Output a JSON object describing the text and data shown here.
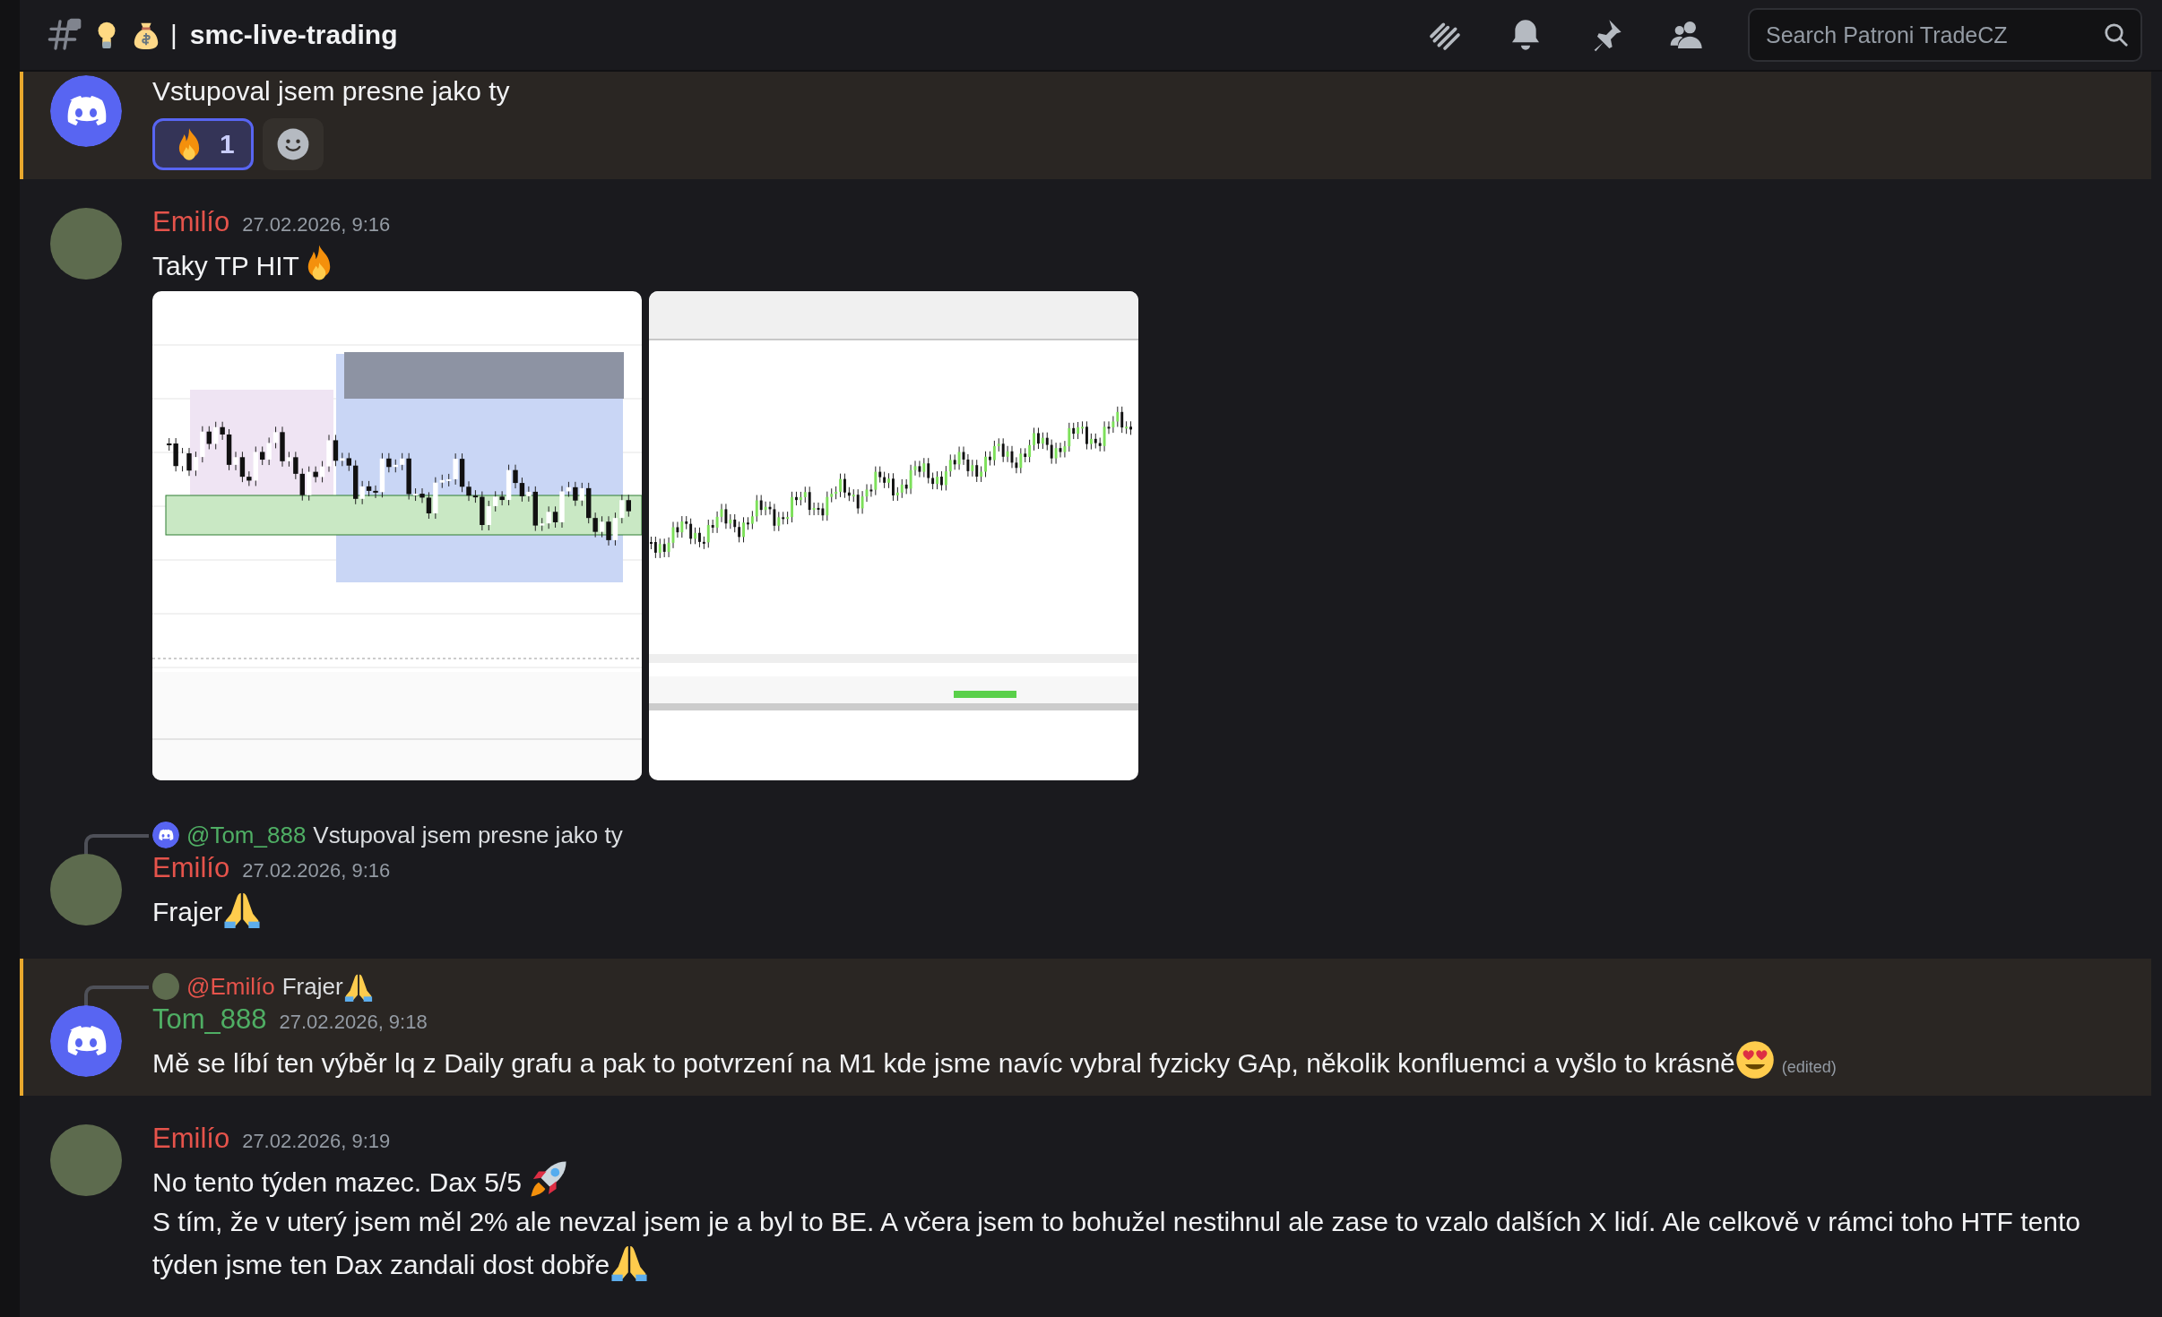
{
  "channel": {
    "emojis": [
      {
        "kind": "bulb"
      },
      {
        "kind": "moneybag"
      }
    ],
    "separator": "|",
    "name": "smc-live-trading"
  },
  "toolbar": [
    {
      "kind": "threads"
    },
    {
      "kind": "bell"
    },
    {
      "kind": "pin"
    },
    {
      "kind": "members"
    }
  ],
  "search": {
    "placeholder": "Search Patroni TradeCZ"
  },
  "messages": [
    {
      "mentioned": true,
      "avatar": {
        "kind": "default"
      },
      "lines": [
        {
          "text": "Vstupoval jsem presne jako ty"
        }
      ],
      "reactions": [
        {
          "emoji": {
            "kind": "fire"
          },
          "count": "1",
          "selected": true
        }
      ],
      "add_reaction": true
    },
    {
      "mentioned": false,
      "avatar": {
        "kind": "photo"
      },
      "author": "Emilío",
      "color": "#e5534b",
      "time": "27.02.2026, 9:16",
      "lines": [
        {
          "text": "Taky TP HIT",
          "emoji": {
            "kind": "fire"
          }
        }
      ],
      "attachments": [
        {
          "kind": "zones"
        },
        {
          "kind": "line"
        }
      ]
    },
    {
      "mentioned": false,
      "avatar": {
        "kind": "photo"
      },
      "reply": {
        "avatar": {
          "kind": "default"
        },
        "mention": "@Tom_888",
        "color": "#4fae64",
        "text": "Vstupoval jsem presne jako ty"
      },
      "author": "Emilío",
      "color": "#e5534b",
      "time": "27.02.2026, 9:16",
      "lines": [
        {
          "text": "Frajer",
          "emoji": {
            "kind": "pray"
          }
        }
      ]
    },
    {
      "mentioned": true,
      "avatar": {
        "kind": "default"
      },
      "reply": {
        "avatar": {
          "kind": "photo"
        },
        "mention": "@Emilío",
        "color": "#e5534b",
        "text": "Frajer",
        "emoji": {
          "kind": "pray"
        }
      },
      "author": "Tom_888",
      "color": "#4fae64",
      "time": "27.02.2026, 9:18",
      "lines": [
        {
          "text": "Mě se líbí ten výběr lq z Daily grafu a pak to potvrzení na M1 kde jsme navíc vybral fyzicky GAp, několik  konfluemci a vyšlo to krásně",
          "emoji": {
            "kind": "heart-eyes"
          },
          "edited": "(edited)"
        }
      ]
    },
    {
      "mentioned": false,
      "avatar": {
        "kind": "photo"
      },
      "author": "Emilío",
      "color": "#e5534b",
      "time": "27.02.2026, 9:19",
      "lines": [
        {
          "text": "No tento týden mazec. Dax 5/5 ",
          "emoji": {
            "kind": "rocket"
          }
        },
        {
          "text": "S tím, že v uterý jsem měl 2% ale nevzal jsem je a byl to BE. A včera jsem to bohužel nestihnul ale zase to vzalo dalších X lidí. Ale celkově v rámci toho HTF tento týden jsme ten Dax zandali dost dobře",
          "emoji": {
            "kind": "pray"
          }
        }
      ]
    }
  ]
}
